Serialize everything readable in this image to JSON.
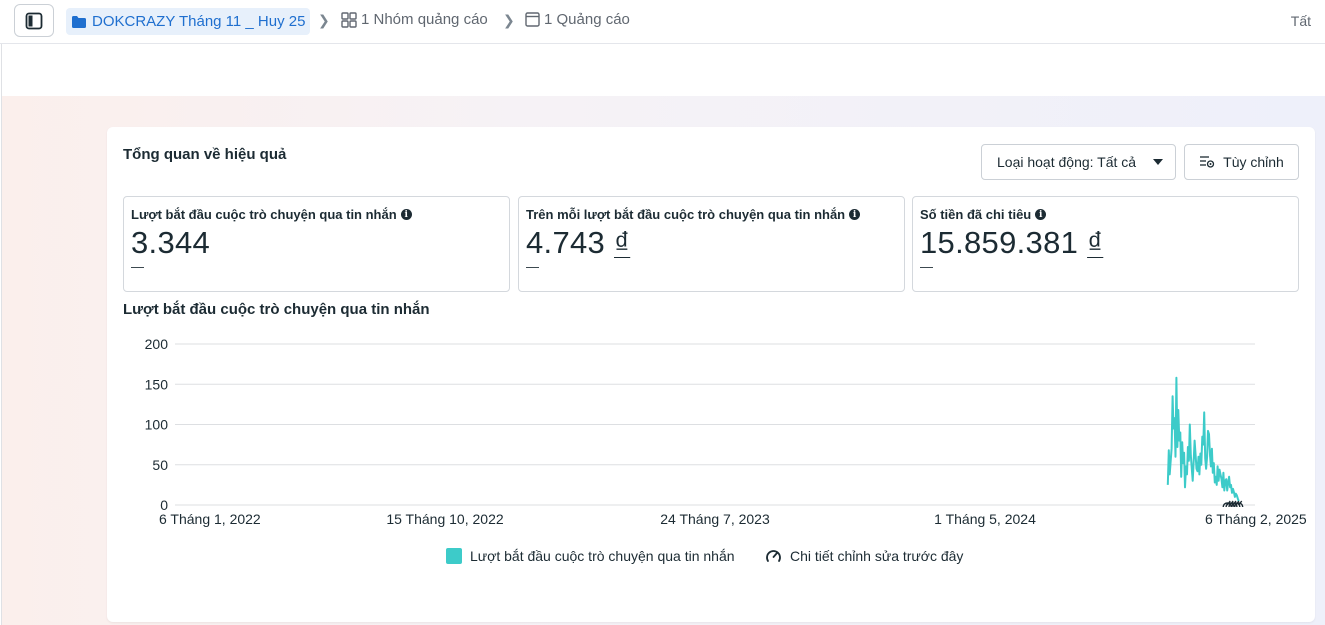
{
  "breadcrumb": {
    "campaign": "DOKCRAZY Tháng 11 _ Huy 25",
    "adsets": "1 Nhóm quảng cáo",
    "ads": "1 Quảng cáo",
    "right": "Tất"
  },
  "card": {
    "title": "Tổng quan về hiệu quả",
    "filter_label": "Loại hoạt động: Tất cả",
    "customize_label": "Tùy chỉnh"
  },
  "metrics": [
    {
      "label": "Lượt bắt đầu cuộc trò chuyện qua tin nhắn",
      "value": "3.344",
      "currency": "",
      "delta": "—"
    },
    {
      "label": "Trên mỗi lượt bắt đầu cuộc trò chuyện qua tin nhắn",
      "value": "4.743",
      "currency": "₫",
      "delta": "—"
    },
    {
      "label": "Số tiền đã chi tiêu",
      "value": "15.859.381",
      "currency": "₫",
      "delta": "—"
    }
  ],
  "chart_data": {
    "type": "line",
    "title": "Lượt bắt đầu cuộc trò chuyện qua tin nhắn",
    "xlabel": "",
    "ylabel": "",
    "ylim": [
      0,
      200
    ],
    "yticks": [
      "0",
      "50",
      "100",
      "150",
      "200"
    ],
    "xticks": [
      "6 Tháng 1, 2022",
      "15 Tháng 10, 2022",
      "24 Tháng 7, 2023",
      "1 Tháng 5, 2024",
      "6 Tháng 2, 2025"
    ],
    "xlim": [
      "2022-01-06",
      "2025-02-06"
    ],
    "grid": true,
    "series": [
      {
        "name": "Lượt bắt đầu cuộc trò chuyện qua tin nhắn",
        "color": "#3dcbc9",
        "x": [
          "2024-11-07",
          "2024-11-08",
          "2024-11-09",
          "2024-11-10",
          "2024-11-11",
          "2024-11-12",
          "2024-11-13",
          "2024-11-14",
          "2024-11-15",
          "2024-11-16",
          "2024-11-17",
          "2024-11-18",
          "2024-11-19",
          "2024-11-20",
          "2024-11-21",
          "2024-11-22",
          "2024-11-23",
          "2024-11-24",
          "2024-11-25",
          "2024-11-26",
          "2024-11-27",
          "2024-11-28",
          "2024-11-29",
          "2024-11-30",
          "2024-12-01",
          "2024-12-02",
          "2024-12-03",
          "2024-12-04",
          "2024-12-05",
          "2024-12-06",
          "2024-12-07",
          "2024-12-08",
          "2024-12-09",
          "2024-12-10",
          "2024-12-11",
          "2024-12-12",
          "2024-12-13",
          "2024-12-14",
          "2024-12-15",
          "2024-12-16",
          "2024-12-17",
          "2024-12-18",
          "2024-12-19",
          "2024-12-20",
          "2024-12-21",
          "2024-12-22",
          "2024-12-23",
          "2024-12-24",
          "2024-12-25",
          "2024-12-26",
          "2024-12-27",
          "2024-12-28",
          "2024-12-29",
          "2024-12-30",
          "2024-12-31",
          "2025-01-01",
          "2025-01-02",
          "2025-01-03",
          "2025-01-04",
          "2025-01-05",
          "2025-01-06",
          "2025-01-07",
          "2025-01-08",
          "2025-01-09",
          "2025-01-10",
          "2025-01-11",
          "2025-01-12",
          "2025-01-13",
          "2025-01-14",
          "2025-01-15",
          "2025-01-16",
          "2025-01-17",
          "2025-01-18",
          "2025-01-19",
          "2025-01-20"
        ],
        "values": [
          25,
          68,
          38,
          55,
          70,
          135,
          95,
          108,
          60,
          158,
          72,
          118,
          80,
          90,
          35,
          78,
          52,
          65,
          22,
          48,
          38,
          72,
          55,
          100,
          62,
          45,
          30,
          55,
          80,
          62,
          45,
          42,
          60,
          38,
          64,
          50,
          85,
          75,
          115,
          58,
          45,
          60,
          92,
          88,
          62,
          48,
          70,
          40,
          52,
          28,
          35,
          25,
          48,
          30,
          44,
          38,
          32,
          22,
          40,
          18,
          30,
          32,
          18,
          28,
          35,
          22,
          25,
          15,
          20,
          16,
          10,
          14,
          12,
          8,
          5
        ]
      }
    ],
    "legend": [
      {
        "label": "Lượt bắt đầu cuộc trò chuyện qua tin nhắn",
        "icon": "square-swatch"
      },
      {
        "label": "Chi tiết chỉnh sửa trước đây",
        "icon": "gauge-icon"
      }
    ]
  }
}
